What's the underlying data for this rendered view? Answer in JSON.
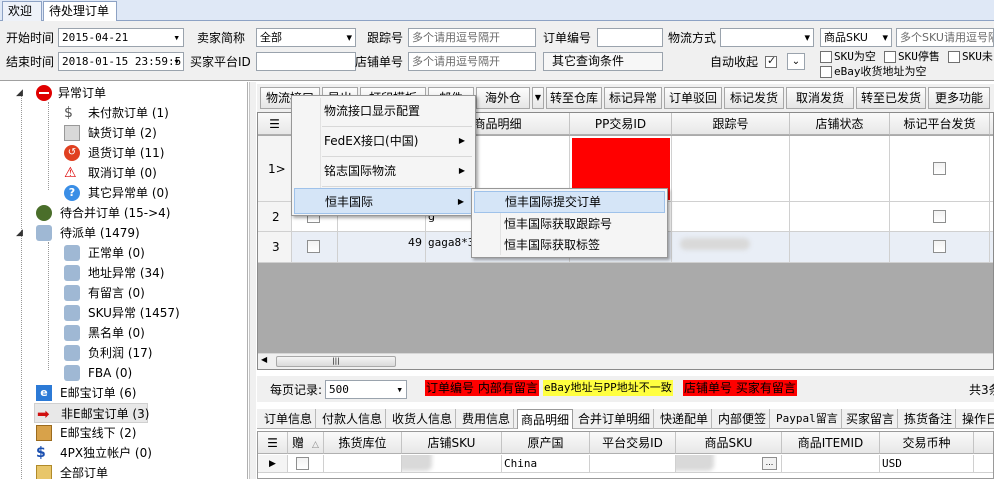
{
  "tabs": [
    "欢迎",
    "待处理订单"
  ],
  "filters": {
    "start_time_label": "开始时间",
    "start_time": "2015-04-21",
    "end_time_label": "结束时间",
    "end_time": "2018-01-15 23:59:5",
    "seller_label": "卖家简称",
    "seller_value": "全部",
    "buyer_platform_label": "买家平台ID",
    "tracking_label": "跟踪号",
    "tracking_placeholder": "多个请用逗号隔开",
    "store_no_label": "店铺单号",
    "store_no_placeholder": "多个请用逗号隔开",
    "order_no_label": "订单编号",
    "other_conditions_label": "其它查询条件",
    "shipping_label": "物流方式",
    "auto_collapse_label": "自动收起",
    "sku_type_value": "商品SKU",
    "sku_placeholder": "多个SKU请用逗号隔",
    "sku_empty_label": "SKU为空",
    "sku_stop_label": "SKU停售",
    "sku_not_label": "SKU未",
    "ebay_addr_empty_label": "eBay收货地址为空"
  },
  "tree": [
    {
      "label": "异常订单",
      "icon": "error-icon"
    },
    {
      "label": "未付款订单 (1)",
      "icon": "dollar-icon"
    },
    {
      "label": "缺货订单 (2)",
      "icon": "box-icon"
    },
    {
      "label": "退货订单 (11)",
      "icon": "return-icon"
    },
    {
      "label": "取消订单 (0)",
      "icon": "warning-icon"
    },
    {
      "label": "其它异常单 (0)",
      "icon": "help-icon"
    },
    {
      "label": "待合并订单 (15->4)",
      "icon": "gear-icon"
    },
    {
      "label": "待派单 (1479)",
      "icon": "user-icon"
    },
    {
      "label": "正常单 (0)",
      "icon": "user-icon"
    },
    {
      "label": "地址异常 (34)",
      "icon": "user-icon"
    },
    {
      "label": "有留言 (0)",
      "icon": "user-icon"
    },
    {
      "label": "SKU异常 (1457)",
      "icon": "user-icon"
    },
    {
      "label": "黑名单 (0)",
      "icon": "user-icon"
    },
    {
      "label": "负利润 (17)",
      "icon": "user-icon"
    },
    {
      "label": "FBA (0)",
      "icon": "user-icon"
    },
    {
      "label": "E邮宝订单 (6)",
      "icon": "ie-icon"
    },
    {
      "label": "非E邮宝订单 (3)",
      "icon": "arrow-icon"
    },
    {
      "label": "E邮宝线下 (2)",
      "icon": "package-icon"
    },
    {
      "label": "4PX独立帐户 (0)",
      "icon": "dollar-icon"
    },
    {
      "label": "全部订单",
      "icon": "folder-icon"
    }
  ],
  "toolbar": [
    "物流接口",
    "导出",
    "打印模板",
    "邮件",
    "海外仓",
    "转至仓库",
    "标记异常",
    "订单驳回",
    "标记发货",
    "取消发货",
    "转至已发货",
    "更多功能"
  ],
  "grid": {
    "headers": [
      "商品明细",
      "PP交易ID",
      "跟踪号",
      "店铺状态",
      "标记平台发货"
    ],
    "rows": [
      {
        "num": "1",
        "qty": "",
        "detail": ""
      },
      {
        "num": "2",
        "qty": "",
        "detail": "g"
      },
      {
        "num": "3",
        "qty": "49",
        "detail": "gaga8*3"
      }
    ],
    "pp_color": "#ff0000"
  },
  "menu1": {
    "items": [
      "物流接口显示配置",
      "FedEX接口(中国)",
      "铭志国际物流",
      "恒丰国际"
    ]
  },
  "menu2": {
    "items": [
      "恒丰国际提交订单",
      "恒丰国际获取跟踪号",
      "恒丰国际获取标签"
    ]
  },
  "status": {
    "per_page_label": "每页记录:",
    "per_page_value": "500",
    "legend1": "订单编号 内部有留言",
    "legend2": "eBay地址与PP地址不一致",
    "legend3": "店铺单号 买家有留言",
    "total": "共3条"
  },
  "bottom_tabs": [
    "订单信息",
    "付款人信息",
    "收货人信息",
    "费用信息",
    "商品明细",
    "合并订单明细",
    "快递配单",
    "内部便签",
    "Paypal留言",
    "买家留言",
    "拣货备注",
    "操作日"
  ],
  "bottom_grid": {
    "headers": [
      "赠",
      "拣货库位",
      "店铺SKU",
      "原产国",
      "平台交易ID",
      "商品SKU",
      "商品ITEMID",
      "交易币种"
    ],
    "row": {
      "country": "China",
      "currency": "USD",
      "more": "..."
    }
  },
  "colors": {
    "legend_red": "#ff0000",
    "legend_yellow": "#ffff40",
    "selected_menu": "#d5e5f7"
  }
}
